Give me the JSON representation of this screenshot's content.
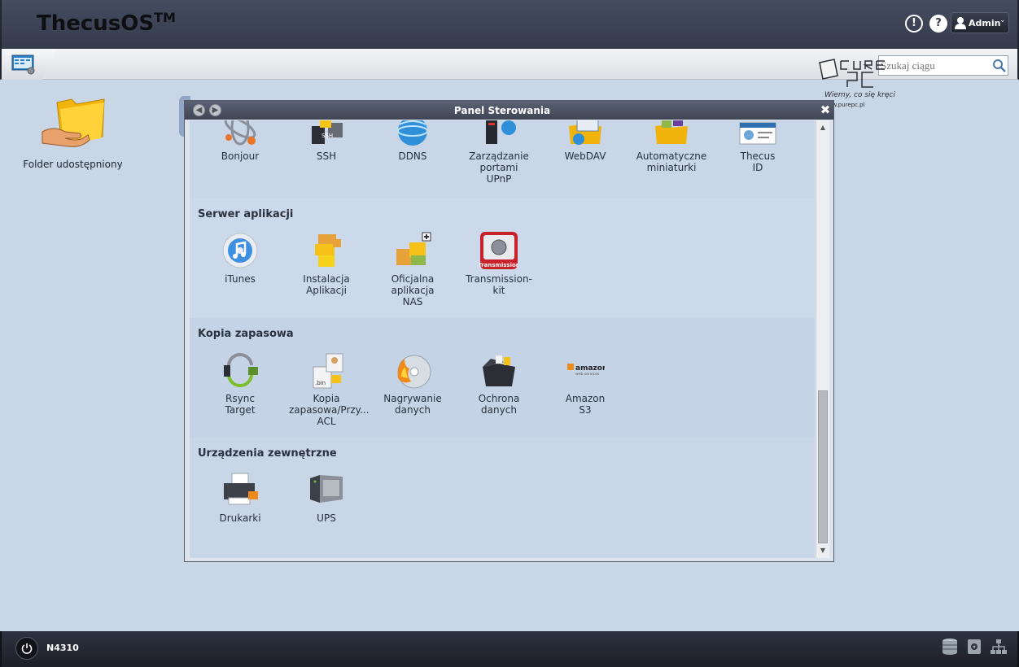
{
  "header": {
    "brand": "ThecusOS",
    "brand_tm": "TM",
    "info_glyph": "!",
    "help_glyph": "?",
    "user_label": "Admin"
  },
  "toolbar": {
    "search_placeholder": "Szukaj ciągu"
  },
  "desktop": {
    "icons": [
      {
        "label": "Folder udostępniony",
        "icon": "shared-folder-icon"
      }
    ]
  },
  "window": {
    "title": "Panel Sterowania",
    "sections": [
      {
        "title": "",
        "items": [
          {
            "label": "Bonjour",
            "icon": "bonjour-icon"
          },
          {
            "label": "SSH",
            "icon": "ssh-icon"
          },
          {
            "label": "DDNS",
            "icon": "ddns-icon"
          },
          {
            "label": "Zarządzanie\nportami\nUPnP",
            "icon": "upnp-icon"
          },
          {
            "label": "WebDAV",
            "icon": "webdav-icon"
          },
          {
            "label": "Automatyczne\nminiaturki",
            "icon": "thumbnails-icon"
          },
          {
            "label": "Thecus\nID",
            "icon": "thecus-id-icon"
          }
        ]
      },
      {
        "title": "Serwer aplikacji",
        "items": [
          {
            "label": "iTunes",
            "icon": "itunes-icon"
          },
          {
            "label": "Instalacja\nAplikacji",
            "icon": "app-install-icon"
          },
          {
            "label": "Oficjalna\naplikacja\nNAS",
            "icon": "official-app-icon"
          },
          {
            "label": "Transmission-kit",
            "icon": "transmission-icon",
            "badge": "Transmission"
          }
        ]
      },
      {
        "title": "Kopia zapasowa",
        "items": [
          {
            "label": "Rsync\nTarget",
            "icon": "rsync-icon"
          },
          {
            "label": "Kopia\nzapasowa/Przy...\nACL",
            "icon": "acl-backup-icon",
            "badge": ".bin"
          },
          {
            "label": "Nagrywanie\ndanych",
            "icon": "disc-burn-icon"
          },
          {
            "label": "Ochrona\ndanych",
            "icon": "data-protection-icon"
          },
          {
            "label": "Amazon\nS3",
            "icon": "amazon-s3-icon",
            "badge": "amazon",
            "badge_sub": "web services"
          }
        ]
      },
      {
        "title": "Urządzenia zewnętrzne",
        "items": [
          {
            "label": "Drukarki",
            "icon": "printer-icon"
          },
          {
            "label": "UPS",
            "icon": "ups-icon"
          }
        ]
      }
    ]
  },
  "watermark": {
    "brand": "PurePC",
    "tagline": "Wiemy, co się kręci !",
    "url": "www.purepc.pl"
  },
  "taskbar": {
    "model": "N4310"
  }
}
